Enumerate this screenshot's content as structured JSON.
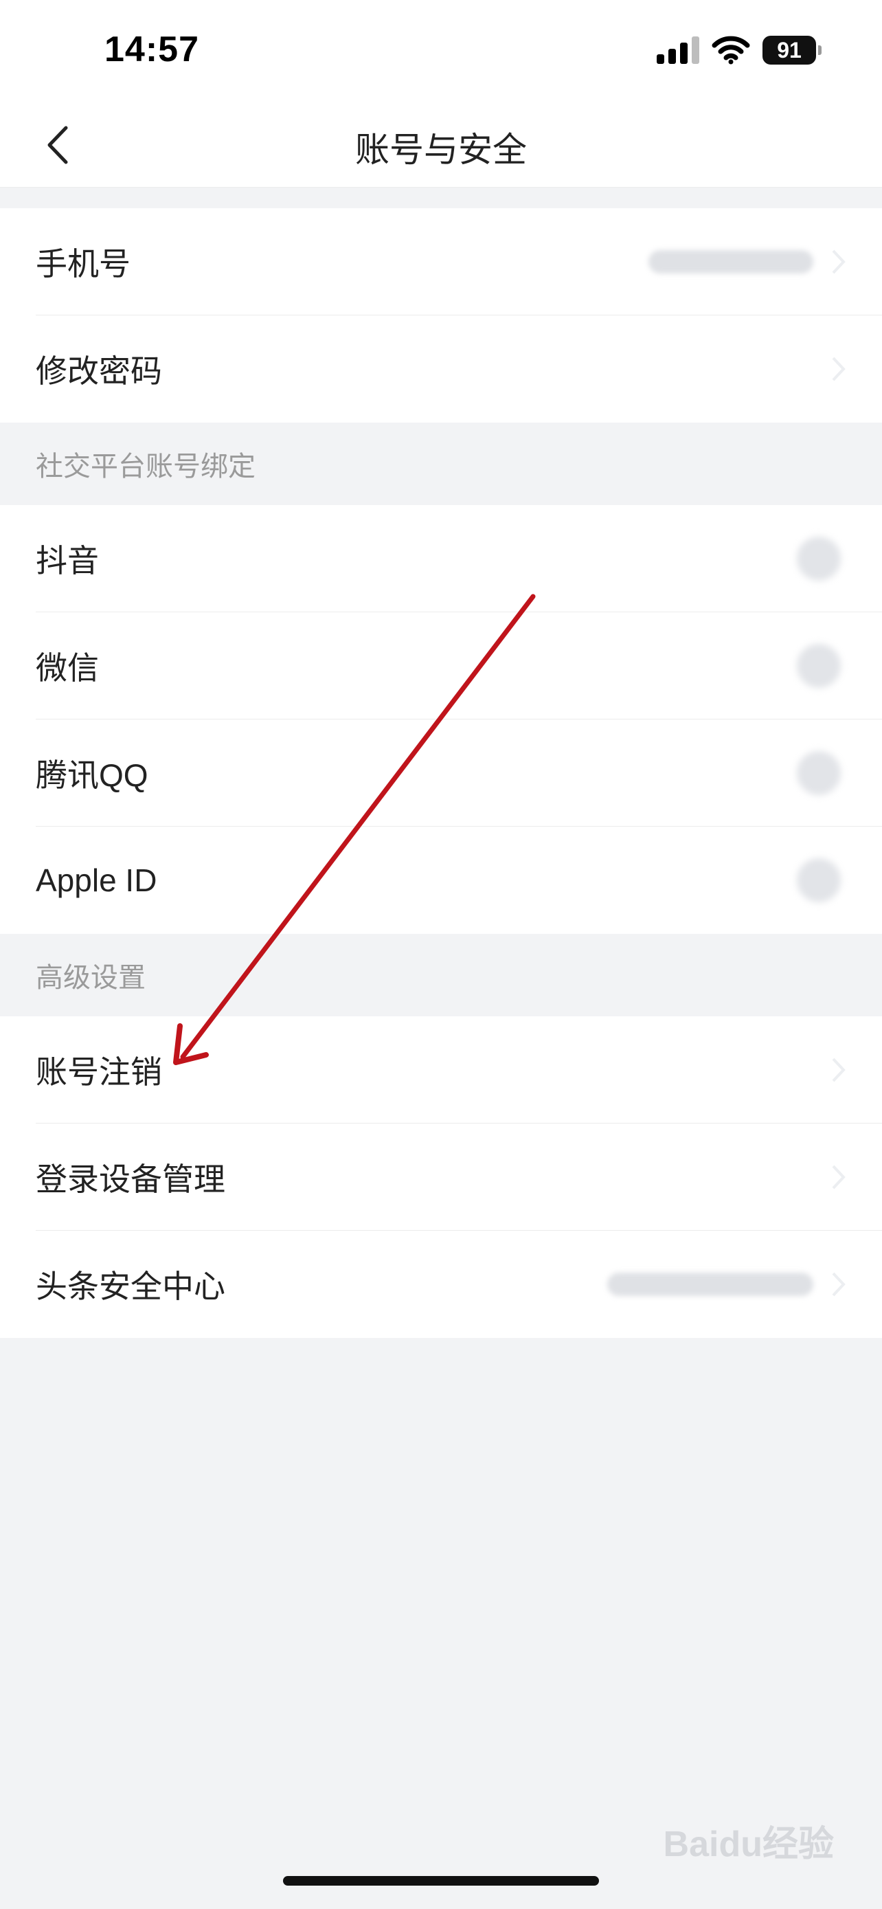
{
  "status_bar": {
    "time": "14:57",
    "battery": "91"
  },
  "nav": {
    "title": "账号与安全"
  },
  "account_rows": [
    {
      "label": "手机号"
    },
    {
      "label": "修改密码"
    }
  ],
  "social_section": {
    "header": "社交平台账号绑定",
    "items": [
      {
        "label": "抖音"
      },
      {
        "label": "微信"
      },
      {
        "label": "腾讯QQ"
      },
      {
        "label": "Apple ID"
      }
    ]
  },
  "advanced_section": {
    "header": "高级设置",
    "items": [
      {
        "label": "账号注销"
      },
      {
        "label": "登录设备管理"
      },
      {
        "label": "头条安全中心"
      }
    ]
  },
  "annotation_color": "#c0141b",
  "watermark": "Baidu经验"
}
